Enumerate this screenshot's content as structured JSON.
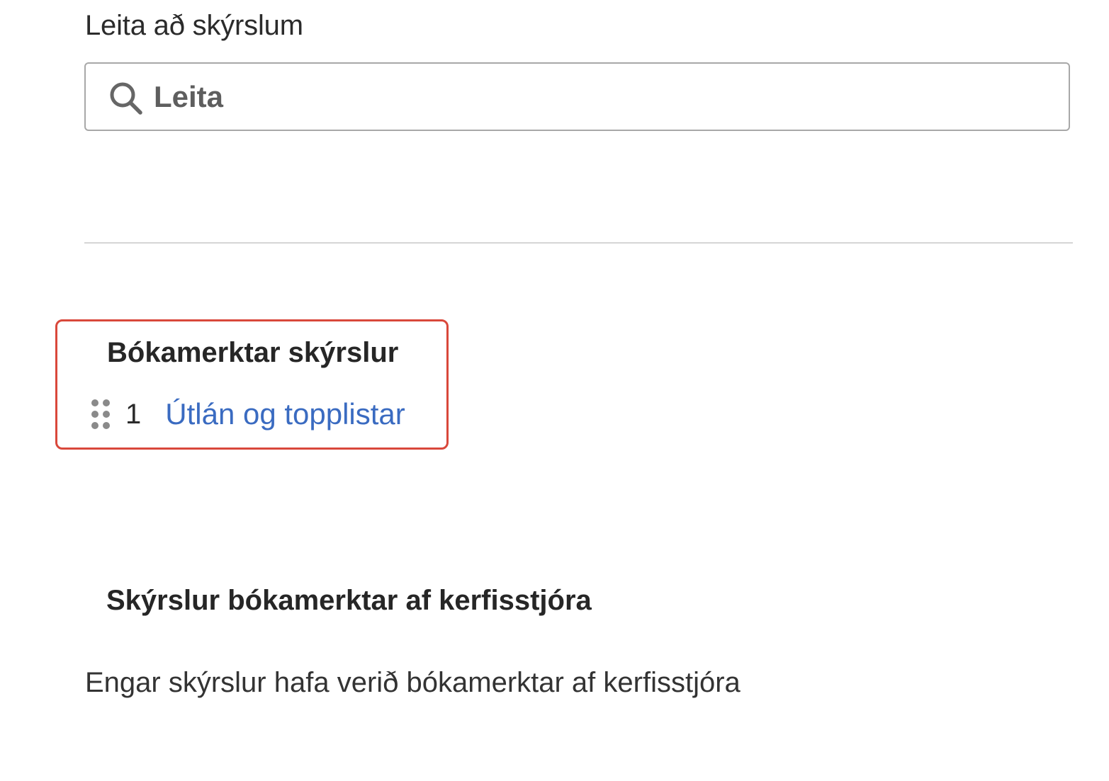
{
  "search": {
    "label": "Leita að skýrslum",
    "placeholder": "Leita",
    "value": "",
    "icon": "search-icon"
  },
  "bookmarks": {
    "heading": "Bókamerktar skýrslur",
    "highlight_color": "#d9483b",
    "items": [
      {
        "index": "1",
        "label": "Útlán og topplistar",
        "icon": "drag-handle-icon"
      }
    ]
  },
  "admin_bookmarks": {
    "heading": "Skýrslur bókamerktar af kerfisstjóra",
    "empty_message": "Engar skýrslur hafa verið bókamerktar af kerfisstjóra"
  },
  "colors": {
    "link": "#3a6bc1",
    "border": "#a8a8a8",
    "divider": "#d6d6d6"
  }
}
